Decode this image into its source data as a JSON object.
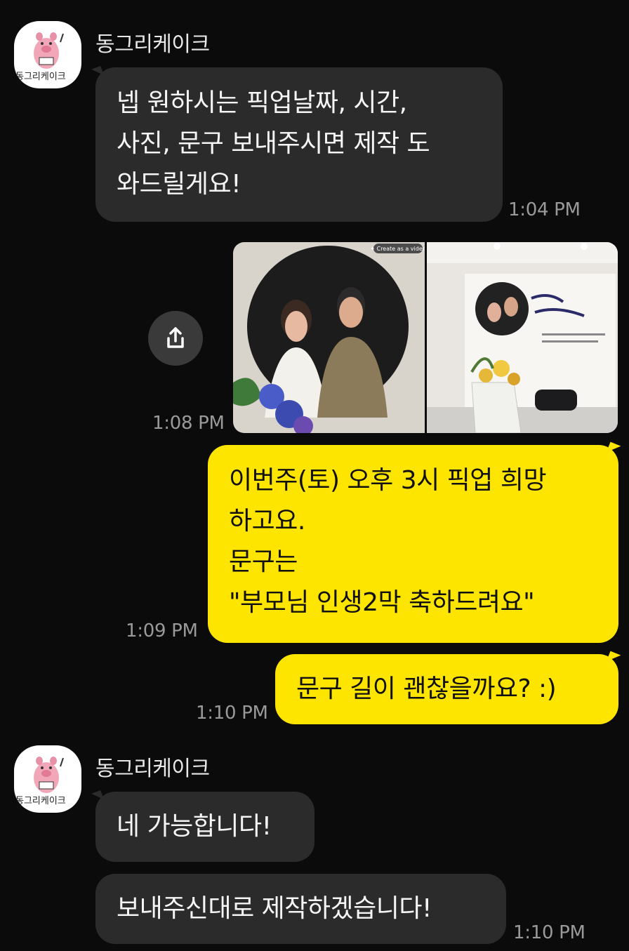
{
  "chat": {
    "messages": [
      {
        "sender": "동그리케이크",
        "avatar_text": "동그리케이크",
        "lines": [
          "넵 원하시는 픽업날짜, 시간,",
          "사진, 문구 보내주시면 제작 도",
          "와드릴게요!"
        ],
        "time": "1:04 PM"
      },
      {
        "photo_badge": "✦ Create as a video",
        "time": "1:08 PM"
      },
      {
        "lines": [
          "이번주(토) 오후 3시 픽업 희망",
          "하고요.",
          "문구는",
          "\"부모님 인생2막 축하드려요\""
        ],
        "time": "1:09 PM"
      },
      {
        "lines": [
          "문구 길이 괜찮을까요? :)"
        ],
        "time": "1:10 PM"
      },
      {
        "sender": "동그리케이크",
        "avatar_text": "동그리케이크",
        "lines": [
          "네 가능합니다!"
        ]
      },
      {
        "lines": [
          "보내주신대로 제작하겠습니다!"
        ],
        "time": "1:10 PM"
      }
    ]
  },
  "colors": {
    "background": "#0b0b0b",
    "incoming_bubble": "#2b2b2b",
    "outgoing_bubble": "#fee500",
    "timestamp": "#9a9a9a"
  },
  "icons": {
    "share": "share-icon",
    "avatar": "pig-mascot-icon"
  }
}
